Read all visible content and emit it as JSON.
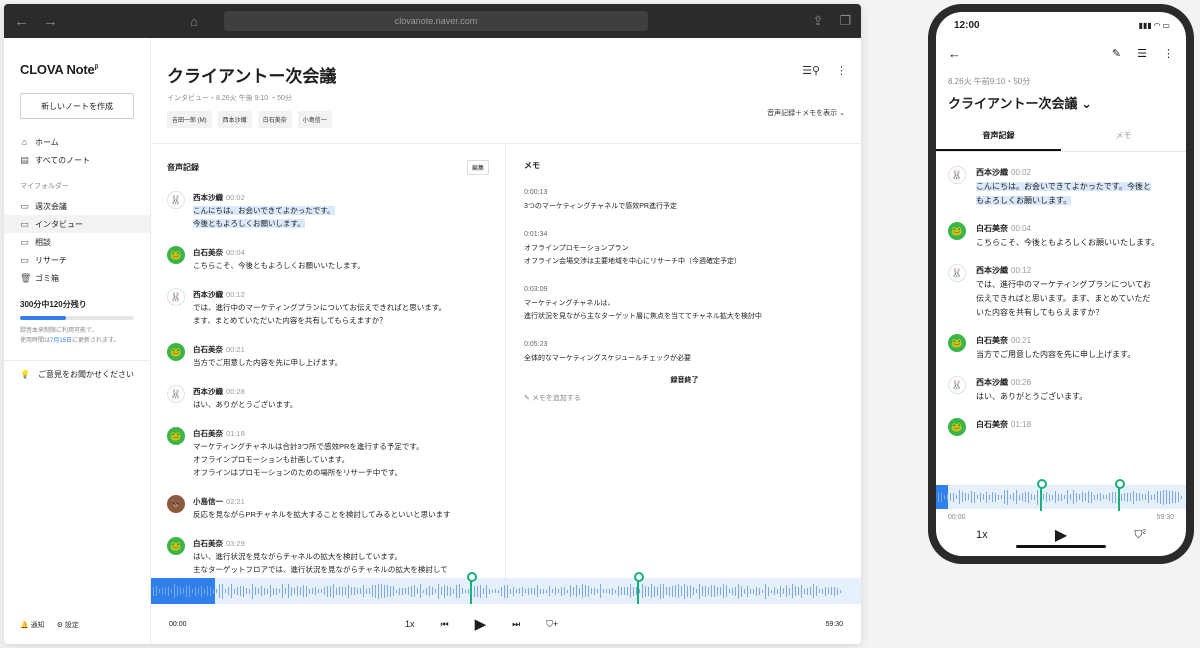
{
  "browser": {
    "url": "clovanote.naver.com"
  },
  "sidebar": {
    "logo": "CLOVA Note",
    "logo_mark": "β",
    "new_note_label": "新しいノートを作成",
    "top_items": [
      {
        "icon": "home-icon",
        "label": "ホーム"
      },
      {
        "icon": "note-list-icon",
        "label": "すべてのノート"
      }
    ],
    "folder_section_label": "マイフォルダー",
    "folders": [
      {
        "icon": "folder-icon",
        "label": "週次会議"
      },
      {
        "icon": "folder-icon",
        "label": "インタビュー"
      },
      {
        "icon": "folder-icon",
        "label": "相談"
      },
      {
        "icon": "folder-icon",
        "label": "リサーチ"
      },
      {
        "icon": "trash-icon",
        "label": "ゴミ箱"
      }
    ],
    "quota_title": "300分中120分残り",
    "quota_fraction": 0.4,
    "quota_note_1": "録音本来制限に利用可能で、",
    "quota_note_2_prefix": "使用時間は",
    "quota_note_2_link": "7月15日",
    "quota_note_2_suffix": "に更新されます。",
    "feedback_label": "ご意見をお聞かせください",
    "bottom_notifications": "通知",
    "bottom_settings": "設定"
  },
  "note": {
    "title": "クライアントー次会議",
    "meta": "インタビュー・8.26火 午後 9:10 ・50分",
    "tags": [
      "吉田一郎 (M)",
      "西本沙織",
      "白石美奈",
      "小島信一"
    ],
    "view_select": "音声記録＋メモを表示"
  },
  "transcript": {
    "title": "音声記録",
    "edit_label": "編集",
    "messages": [
      {
        "avatar": "w",
        "speaker": "西本沙織",
        "time": "00:02",
        "lines": [
          "こんにちは。お会いできてよかったです。",
          "今後ともよろしくお願いします。"
        ],
        "highlight": true
      },
      {
        "avatar": "g",
        "speaker": "白石美奈",
        "time": "00:04",
        "lines": [
          "こちらこそ、今後ともよろしくお願いいたします。"
        ]
      },
      {
        "avatar": "w",
        "speaker": "西本沙織",
        "time": "00:12",
        "lines": [
          "では、進行中のマーケティングプランについてお伝えできればと思います。",
          "ます、まとめていただいた内容を共有してもらえますか？"
        ]
      },
      {
        "avatar": "g",
        "speaker": "白石美奈",
        "time": "00:21",
        "lines": [
          "当方でご用意した内容を先に申し上げます。"
        ]
      },
      {
        "avatar": "w",
        "speaker": "西本沙織",
        "time": "00:28",
        "lines": [
          "はい、ありがとうございます。"
        ]
      },
      {
        "avatar": "g",
        "speaker": "白石美奈",
        "time": "01:18",
        "lines": [
          "マーケティングチャネルは合計3つ所で感效PRを進行する予定です。",
          "オフラインプロモーションも計画しています。",
          "オフラインはプロモーションのための場所をリサーチ中です。"
        ]
      },
      {
        "avatar": "b",
        "speaker": "小島信一",
        "time": "02:21",
        "lines": [
          "反応を見ながらPRチャネルを拡大することを検討してみるといいと思います"
        ]
      },
      {
        "avatar": "g",
        "speaker": "白石美奈",
        "time": "03:29",
        "lines": [
          "はい、進行状況を見ながらチャネルの拡大を検討しています。",
          "主なターゲットフロアでは、進行状況を見ながらチャネルの拡大を検討して"
        ]
      }
    ]
  },
  "memo": {
    "title": "メモ",
    "entries": [
      {
        "time": "0:00:13",
        "lines": [
          "3つのマーケティングチャネルで感效PR進行予定"
        ]
      },
      {
        "time": "0:01:34",
        "lines": [
          "オフラインプロモーションプラン",
          "オフライン会場交渉は主要地域を中心にリサーチ中（今週確定予定）"
        ]
      },
      {
        "time": "0:03:09",
        "lines": [
          "マーケティングチャネルは、",
          "進行状況を見ながら主なターゲット層に焦点を当ててチャネル拡大を検討中"
        ]
      },
      {
        "time": "0:05:23",
        "lines": [
          "全体的なマーケティングスケジュールチェックが必要"
        ]
      }
    ],
    "end_label": "録音終了",
    "add_label": "メモを追加する"
  },
  "player": {
    "start": "00:00",
    "speed": "1x",
    "end": "59:30",
    "played_fraction": 0.09
  },
  "phone": {
    "clock": "12:00",
    "meta": "8.26火 午前9:10・50分",
    "title": "クライアントー次会議",
    "tab_transcript": "音声記録",
    "tab_memo": "メモ",
    "messages": [
      {
        "avatar": "w",
        "speaker": "西本沙織",
        "time": "00:02",
        "lines": [
          "こんにちは。お会いできてよかったです。今後と",
          "もよろしくお願いします。"
        ],
        "highlight": true
      },
      {
        "avatar": "g",
        "speaker": "白石美奈",
        "time": "00:04",
        "lines": [
          "こちらこそ、今後ともよろしくお願いいたします。"
        ]
      },
      {
        "avatar": "w",
        "speaker": "西本沙織",
        "time": "00:12",
        "lines": [
          "では、進行中のマーケティングプランについてお",
          "伝えできればと思います。ます、まとめていただ",
          "いた内容を共有してもらえますか？"
        ]
      },
      {
        "avatar": "g",
        "speaker": "白石美奈",
        "time": "00:21",
        "lines": [
          "当方でご用意した内容を先に申し上げます。"
        ]
      },
      {
        "avatar": "w",
        "speaker": "西本沙織",
        "time": "00:28",
        "lines": [
          "はい、ありがとうございます。"
        ]
      },
      {
        "avatar": "g",
        "speaker": "白石美奈",
        "time": "01:18",
        "lines": []
      }
    ],
    "start": "00:00",
    "end": "59:30",
    "speed": "1x",
    "bookmark_count": "2"
  },
  "colors": {
    "accent": "#2f80ed",
    "marker": "#18b07a",
    "highlight": "#d9e8fb"
  }
}
